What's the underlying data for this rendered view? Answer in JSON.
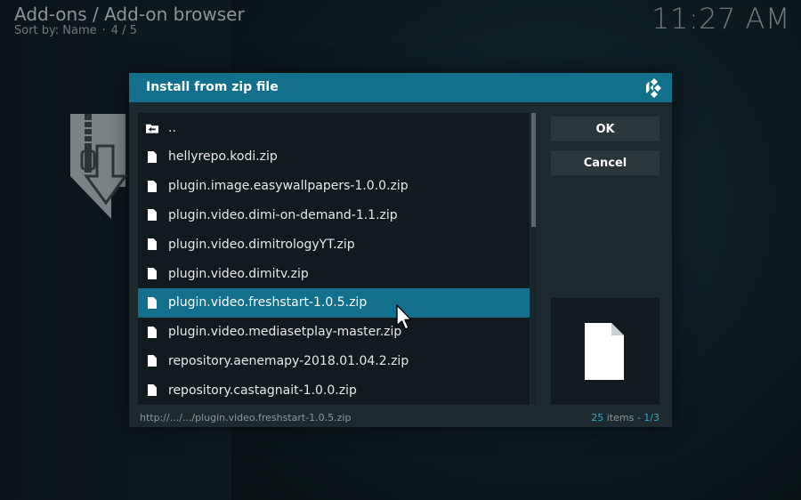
{
  "header": {
    "title": "Add-ons / Add-on browser",
    "sort_label": "Sort by: Name",
    "page_indicator": "4 / 5"
  },
  "clock": "11:27 AM",
  "dialog": {
    "title": "Install from zip file",
    "logo_icon": "kodi-logo-icon",
    "buttons": {
      "ok": "OK",
      "cancel": "Cancel"
    },
    "files": [
      {
        "label": "..",
        "icon": "folder-back-icon"
      },
      {
        "label": "hellyrepo.kodi.zip",
        "icon": "file-icon"
      },
      {
        "label": "plugin.image.easywallpapers-1.0.0.zip",
        "icon": "file-icon"
      },
      {
        "label": "plugin.video.dimi-on-demand-1.1.zip",
        "icon": "file-icon"
      },
      {
        "label": "plugin.video.dimitrologyYT.zip",
        "icon": "file-icon"
      },
      {
        "label": "plugin.video.dimitv.zip",
        "icon": "file-icon"
      },
      {
        "label": "plugin.video.freshstart-1.0.5.zip",
        "icon": "file-icon",
        "selected": true
      },
      {
        "label": "plugin.video.mediasetplay-master.zip",
        "icon": "file-icon"
      },
      {
        "label": "repository.aenemapy-2018.01.04.2.zip",
        "icon": "file-icon"
      },
      {
        "label": "repository.castagnait-1.0.0.zip",
        "icon": "file-icon"
      }
    ],
    "footer": {
      "path": "http://.../.../plugin.video.freshstart-1.0.5.zip",
      "item_count": "25",
      "items_label": "items - ",
      "page": "1/3"
    }
  },
  "colors": {
    "accent": "#12708d",
    "dialog_bg": "#1c2a2f",
    "list_bg": "#111b1f",
    "button_bg": "#2a363a",
    "count_highlight": "#3aa3c8"
  }
}
